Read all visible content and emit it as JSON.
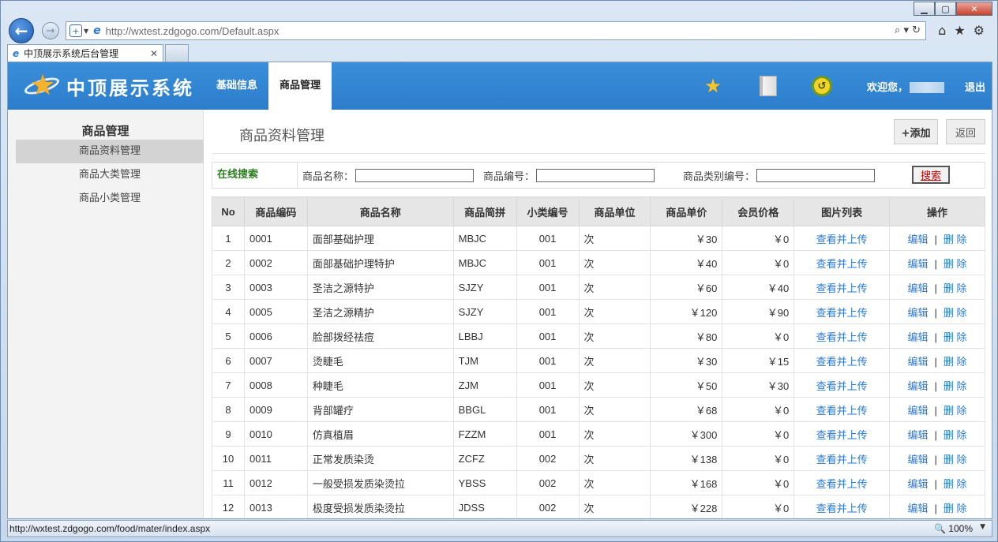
{
  "browser": {
    "url": "http://wxtest.zdgogo.com/Default.aspx",
    "tab_title": "中顶展示系统后台管理",
    "status_url": "http://wxtest.zdgogo.com/food/mater/index.aspx",
    "zoom": "100%"
  },
  "header": {
    "logo_text": "中顶展示系统",
    "nav": [
      "基础信息",
      "商品管理"
    ],
    "active_nav": "商品管理",
    "welcome": "欢迎您，",
    "logout": "退出"
  },
  "sidebar": {
    "title": "商品管理",
    "items": [
      "商品资料管理",
      "商品大类管理",
      "商品小类管理"
    ]
  },
  "page": {
    "title": "商品资料管理",
    "add_label": "+添加",
    "back_label": "返回"
  },
  "search": {
    "label": "在线搜索",
    "fields": [
      "商品名称：",
      "商品编号：",
      "商品类别编号："
    ],
    "button": "搜索"
  },
  "table": {
    "columns": [
      "No",
      "商品编码",
      "商品名称",
      "商品简拼",
      "小类编号",
      "商品单位",
      "商品单价",
      "会员价格",
      "图片列表",
      "操作"
    ],
    "link_text": "查看并上传",
    "edit": "编辑",
    "delete": "删 除",
    "rows": [
      [
        "1",
        "0001",
        "面部基础护理",
        "MBJC",
        "001",
        "次",
        "￥30",
        "￥0"
      ],
      [
        "2",
        "0002",
        "面部基础护理特护",
        "MBJC",
        "001",
        "次",
        "￥40",
        "￥0"
      ],
      [
        "3",
        "0003",
        "圣洁之源特护",
        "SJZY",
        "001",
        "次",
        "￥60",
        "￥40"
      ],
      [
        "4",
        "0005",
        "圣洁之源精护",
        "SJZY",
        "001",
        "次",
        "￥120",
        "￥90"
      ],
      [
        "5",
        "0006",
        "脸部拨经祛痘",
        "LBBJ",
        "001",
        "次",
        "￥80",
        "￥0"
      ],
      [
        "6",
        "0007",
        "烫睫毛",
        "TJM",
        "001",
        "次",
        "￥30",
        "￥15"
      ],
      [
        "7",
        "0008",
        "种睫毛",
        "ZJM",
        "001",
        "次",
        "￥50",
        "￥30"
      ],
      [
        "8",
        "0009",
        "背部罐疗",
        "BBGL",
        "001",
        "次",
        "￥68",
        "￥0"
      ],
      [
        "9",
        "0010",
        "仿真植眉",
        "FZZM",
        "001",
        "次",
        "￥300",
        "￥0"
      ],
      [
        "10",
        "0011",
        "正常发质染烫",
        "ZCFZ",
        "002",
        "次",
        "￥138",
        "￥0"
      ],
      [
        "11",
        "0012",
        "一般受损发质染烫拉",
        "YBSS",
        "002",
        "次",
        "￥168",
        "￥0"
      ],
      [
        "12",
        "0013",
        "极度受损发质染烫拉",
        "JDSS",
        "002",
        "次",
        "￥228",
        "￥0"
      ]
    ]
  }
}
